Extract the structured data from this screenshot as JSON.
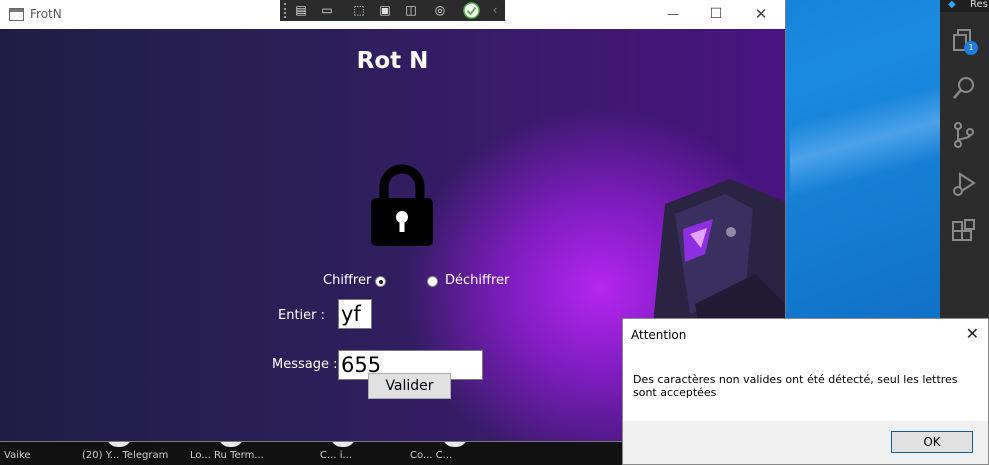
{
  "window": {
    "title": "FrotN",
    "controls": {
      "minimize": "—",
      "maximize": "☐",
      "close": "✕"
    }
  },
  "app": {
    "heading": "Rot N",
    "radio_encrypt": "Chiffrer",
    "radio_decrypt": "Déchiffrer",
    "selected_mode": "Chiffrer",
    "label_integer": "Entier :",
    "value_integer": "yf",
    "label_message": "Message :",
    "value_message": "655",
    "submit_label": "Valider"
  },
  "dialog": {
    "title": "Attention",
    "message": "Des caractères non valides ont été détecté, seul les lettres sont acceptées",
    "ok_label": "OK"
  },
  "vscode": {
    "title_fragment": "Res",
    "explorer_badge": "1"
  },
  "taskbar": {
    "labels": [
      "Vaike",
      "(20) Y... Telegram",
      "Lo... Ru Term...",
      "C... i...",
      "Co... C..."
    ]
  },
  "colors": {
    "app_bg_dark": "#1f1d45",
    "app_glow": "#b526f0",
    "desktop": "#0b6fc2",
    "vscode_bar": "#2c2c2c"
  }
}
